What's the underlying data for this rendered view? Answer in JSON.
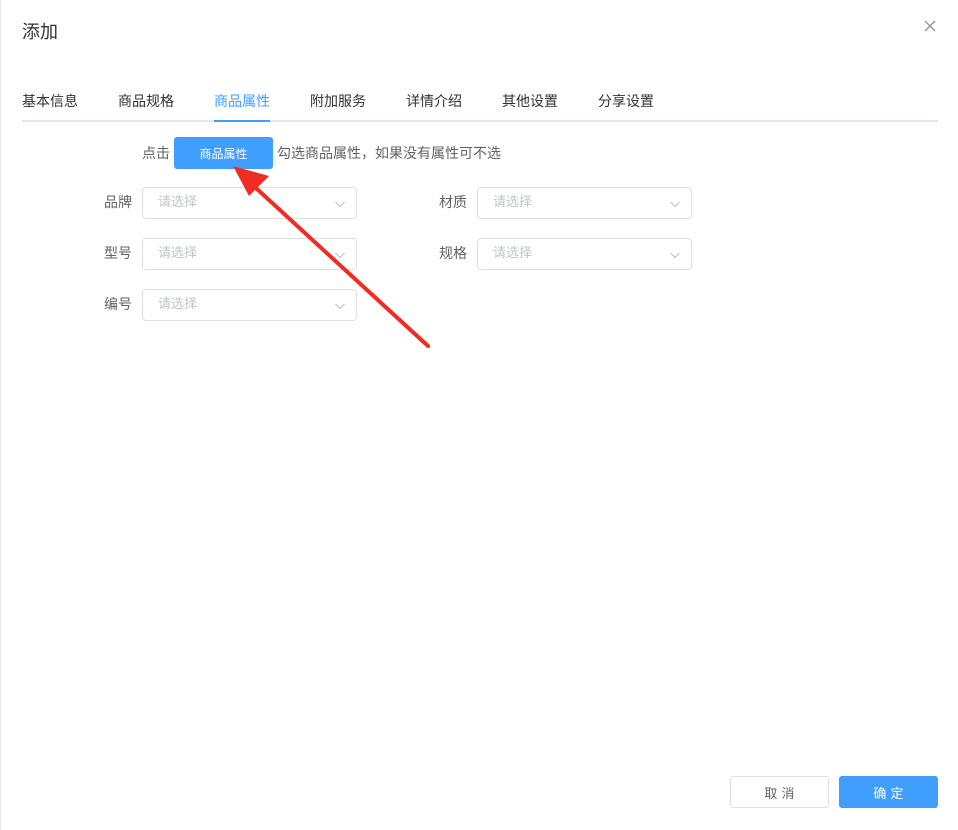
{
  "dialog": {
    "title": "添加"
  },
  "tabs": [
    {
      "label": "基本信息"
    },
    {
      "label": "商品规格"
    },
    {
      "label": "商品属性"
    },
    {
      "label": "附加服务"
    },
    {
      "label": "详情介绍"
    },
    {
      "label": "其他设置"
    },
    {
      "label": "分享设置"
    }
  ],
  "active_tab": "商品属性",
  "hint": {
    "prefix": "点击",
    "button_label": "商品属性",
    "suffix": "勾选商品属性，如果没有属性可不选"
  },
  "fields": {
    "brand": {
      "label": "品牌",
      "placeholder": "请选择"
    },
    "material": {
      "label": "材质",
      "placeholder": "请选择"
    },
    "model": {
      "label": "型号",
      "placeholder": "请选择"
    },
    "spec": {
      "label": "规格",
      "placeholder": "请选择"
    },
    "code": {
      "label": "编号",
      "placeholder": "请选择"
    }
  },
  "footer": {
    "cancel_label": "取 消",
    "confirm_label": "确 定"
  },
  "colors": {
    "primary": "#409eff",
    "annotation_arrow": "#f02d22"
  },
  "icons": {
    "close": "close-icon",
    "dropdown": "chevron-down-icon"
  }
}
